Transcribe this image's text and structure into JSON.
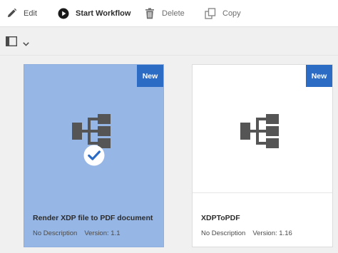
{
  "toolbar": {
    "edit_label": "Edit",
    "start_workflow_label": "Start Workflow",
    "delete_label": "Delete",
    "copy_label": "Copy"
  },
  "viewbar": {
    "view_icon": "list-view-icon",
    "chevron_icon": "chevron-down-icon"
  },
  "cards": [
    {
      "badge": "New",
      "title": "Render XDP file to PDF document",
      "description": "No Description",
      "version": "Version: 1.1",
      "selected": true,
      "icon": "workflow-model-icon"
    },
    {
      "badge": "New",
      "title": "XDPToPDF",
      "description": "No Description",
      "version": "Version: 1.16",
      "selected": false,
      "icon": "workflow-model-icon"
    }
  ],
  "colors": {
    "selected_card": "#96b6e5",
    "badge": "#2d6cc5",
    "icon_grey": "#555555"
  }
}
